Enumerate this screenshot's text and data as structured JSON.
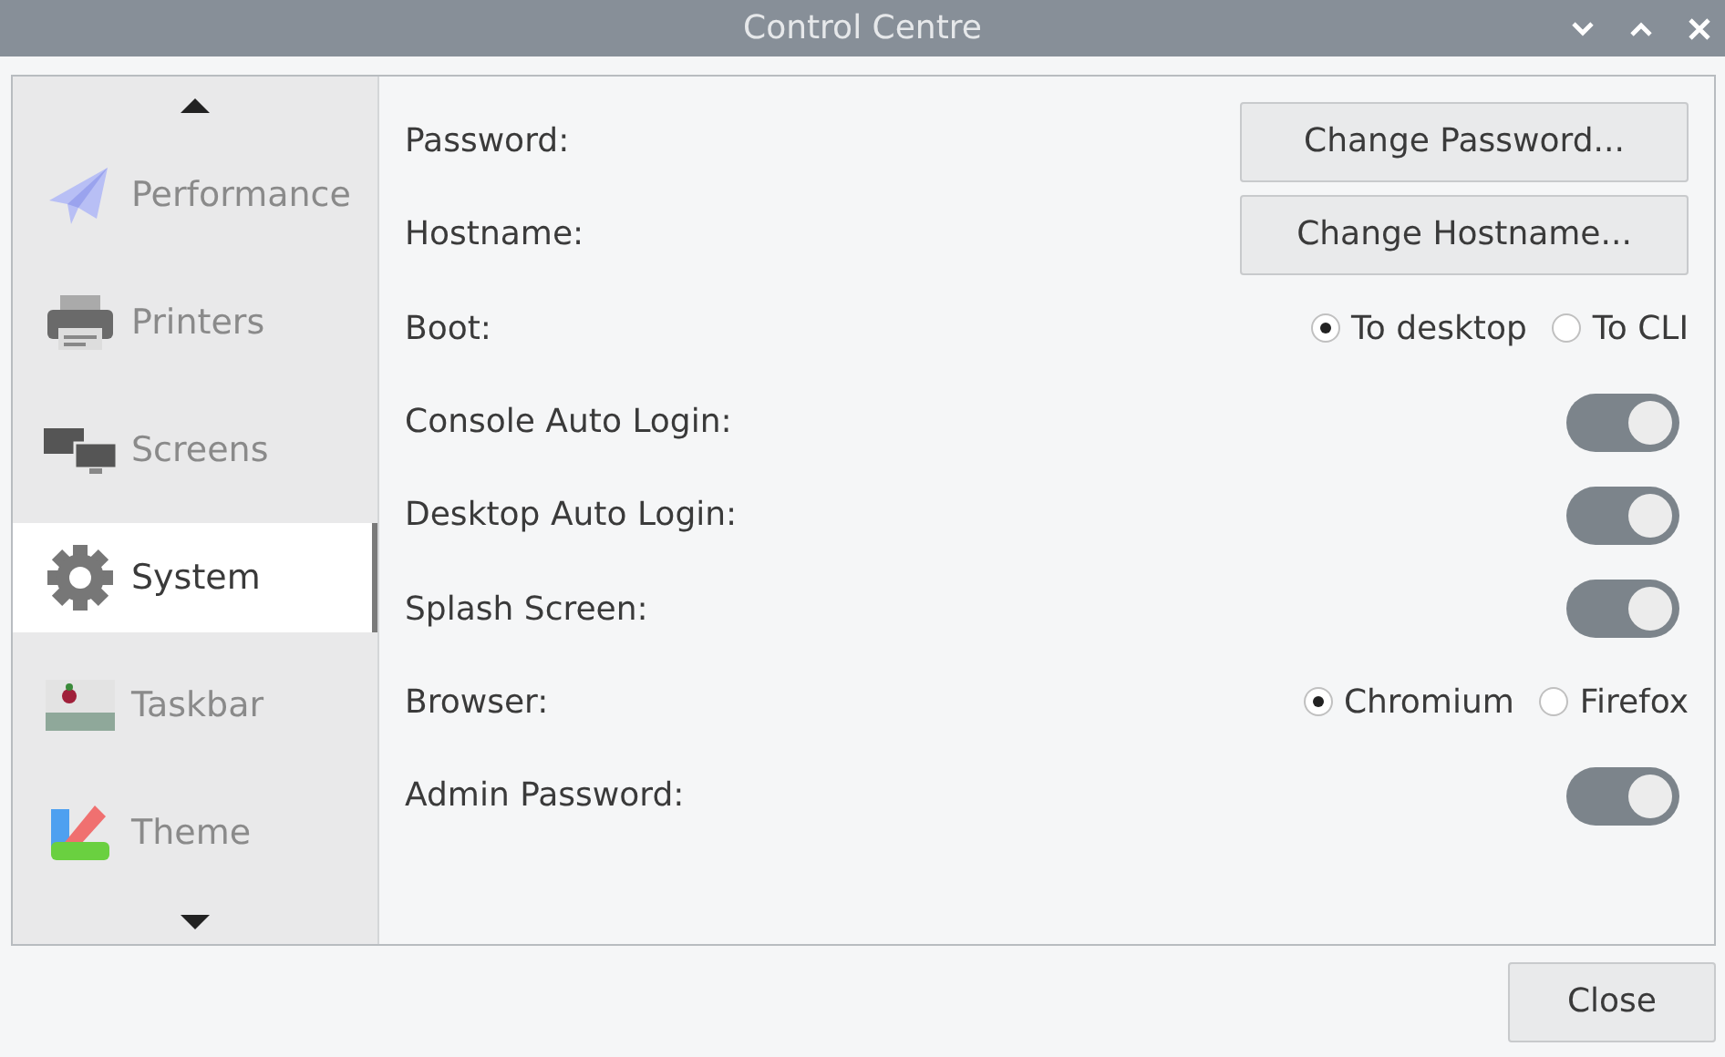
{
  "window": {
    "title": "Control Centre"
  },
  "sidebar": {
    "items": [
      {
        "label": "Performance",
        "kind": "plane",
        "selected": false
      },
      {
        "label": "Printers",
        "kind": "printer",
        "selected": false
      },
      {
        "label": "Screens",
        "kind": "screens",
        "selected": false
      },
      {
        "label": "System",
        "kind": "gear",
        "selected": true
      },
      {
        "label": "Taskbar",
        "kind": "taskbar",
        "selected": false
      },
      {
        "label": "Theme",
        "kind": "theme",
        "selected": false
      }
    ]
  },
  "settings": [
    {
      "kind": "button",
      "label": "Password:",
      "button": "Change Password..."
    },
    {
      "kind": "button",
      "label": "Hostname:",
      "button": "Change Hostname..."
    },
    {
      "kind": "radio",
      "label": "Boot:",
      "options": [
        {
          "label": "To desktop",
          "selected": true
        },
        {
          "label": "To CLI",
          "selected": false
        }
      ]
    },
    {
      "kind": "toggle",
      "label": "Console Auto Login:",
      "on": true
    },
    {
      "kind": "toggle",
      "label": "Desktop Auto Login:",
      "on": true
    },
    {
      "kind": "toggle",
      "label": "Splash Screen:",
      "on": true
    },
    {
      "kind": "radio",
      "label": "Browser:",
      "options": [
        {
          "label": "Chromium",
          "selected": true
        },
        {
          "label": "Firefox",
          "selected": false
        }
      ]
    },
    {
      "kind": "toggle",
      "label": "Admin Password:",
      "on": true
    }
  ],
  "buttons": [
    "Close"
  ]
}
